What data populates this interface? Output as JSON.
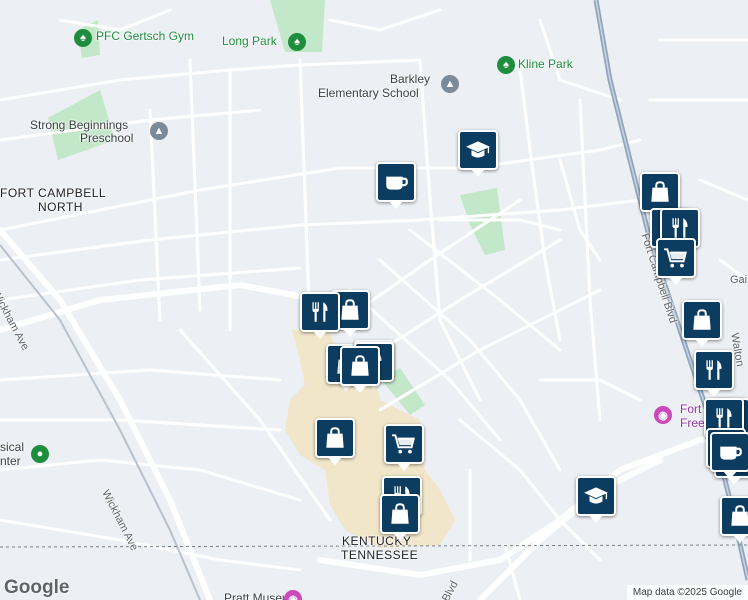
{
  "map": {
    "background_color": "#eceff3",
    "road_color": "#ffffff",
    "highway_color": "#8fa5bf",
    "park_color": "#c3e8c9",
    "commercial_color": "#f1e6c9",
    "marker_color": "#0c3c60"
  },
  "places": {
    "gym": "PFC Gertsch Gym",
    "long_park": "Long Park",
    "kline_park": "Kline Park",
    "barkley_line1": "Barkley",
    "barkley_line2": "Elementary School",
    "strong_line1": "Strong Beginnings",
    "strong_line2": "Preschool",
    "fcn_line1": "FORT CAMPBELL",
    "fcn_line2": "NORTH",
    "musical_line1": "sical",
    "musical_line2": "nter",
    "fort_freedom_line1": "Fort",
    "fort_freedom_line2": "Free",
    "pratt": "Pratt Museum"
  },
  "streets": {
    "wickham_ave_a": "Wickham Ave",
    "wickham_ave_b": "Wickham Ave",
    "fort_campbell_blvd": "Fort Campbell Blvd",
    "blvd": "Blvd",
    "gain": "Gain",
    "walton": "Walton"
  },
  "state_line": {
    "kentucky": "KENTUCKY",
    "tennessee": "TENNESSEE"
  },
  "branding": {
    "google_logo": "Google",
    "attribution": "Map data ©2025 Google"
  },
  "markers": [
    {
      "icon": "graduation-cap-icon"
    },
    {
      "icon": "coffee-cup-icon"
    },
    {
      "icon": "shopping-bag-icon"
    },
    {
      "icon": "restaurant-icon"
    },
    {
      "icon": "restaurant-icon"
    },
    {
      "icon": "shopping-cart-icon"
    },
    {
      "icon": "shopping-bag-icon"
    },
    {
      "icon": "restaurant-icon"
    },
    {
      "icon": "shopping-bag-icon"
    },
    {
      "icon": "restaurant-icon"
    },
    {
      "icon": "shopping-bag-icon"
    },
    {
      "icon": "restaurant-icon"
    },
    {
      "icon": "shopping-bag-icon"
    },
    {
      "icon": "shopping-cart-icon"
    },
    {
      "icon": "restaurant-icon"
    },
    {
      "icon": "shopping-bag-icon"
    },
    {
      "icon": "shopping-bag-icon"
    },
    {
      "icon": "restaurant-icon"
    },
    {
      "icon": "graduation-cap-icon"
    },
    {
      "icon": "coffee-cup-icon"
    },
    {
      "icon": "shopping-bag-icon"
    }
  ]
}
